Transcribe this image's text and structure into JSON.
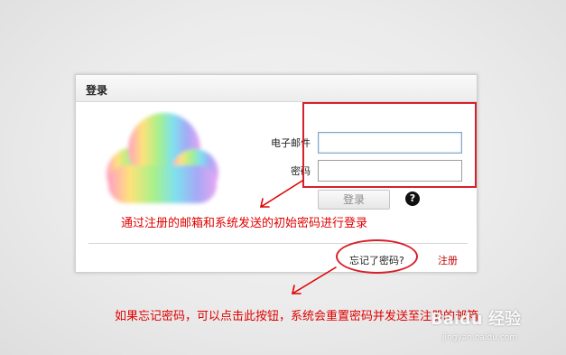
{
  "panel": {
    "title": "登录",
    "email_label": "电子邮件",
    "password_label": "密码",
    "email_value": "",
    "password_value": "",
    "login_button": "登录",
    "help_icon": "?",
    "forgot_link": "忘记了密码?",
    "register_link": "注册"
  },
  "annotations": {
    "note_1": "通过注册的邮箱和系统发送的初始密码进行登录",
    "note_2": "如果忘记密码，可以点击此按钮，系统会重置密码并发送至注册的邮箱"
  },
  "watermark": {
    "brand": "Baidu 经验",
    "url": "jingyan.baidu.com"
  },
  "colors": {
    "annotation_red": "#e00000",
    "register_red": "#c00000",
    "field_focus_border": "#7fa7c9"
  },
  "icons": [
    "cloud-logo-icon",
    "help-icon",
    "arrow-icon"
  ]
}
